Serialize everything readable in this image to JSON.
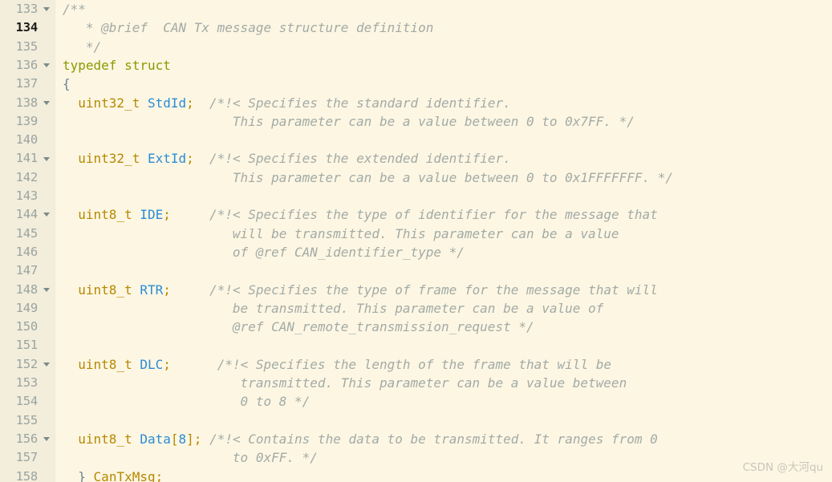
{
  "editor": {
    "language": "c",
    "first_line_number": 133,
    "current_line_number": 134,
    "colors": {
      "background": "#fdf6e3",
      "gutter_background": "#f3eddb",
      "line_number": "#9aa5a1",
      "current_line_number": "#1c1c1c",
      "comment": "#a2aba6",
      "type": "#b58900",
      "identifier": "#2b8cd4",
      "keyword": "#8a9a00",
      "punctuation": "#6a8391",
      "plain": "#657b83",
      "watermark": "#c9c6bd"
    }
  },
  "watermark": {
    "text": "CSDN @大河qu"
  },
  "lines": [
    {
      "number": "133",
      "fold": true,
      "current": false,
      "tokens": [
        {
          "t": "/**",
          "k": "com"
        }
      ]
    },
    {
      "number": "134",
      "fold": false,
      "current": true,
      "tokens": [
        {
          "t": "   * @brief  CAN Tx message structure definition",
          "k": "com"
        }
      ]
    },
    {
      "number": "135",
      "fold": false,
      "current": false,
      "tokens": [
        {
          "t": "   */",
          "k": "com"
        }
      ]
    },
    {
      "number": "136",
      "fold": true,
      "current": false,
      "tokens": [
        {
          "t": "typedef struct",
          "k": "kw"
        }
      ]
    },
    {
      "number": "137",
      "fold": false,
      "current": false,
      "tokens": [
        {
          "t": "{",
          "k": "punc"
        }
      ]
    },
    {
      "number": "138",
      "fold": true,
      "current": false,
      "tokens": [
        {
          "t": "  ",
          "k": "plain"
        },
        {
          "t": "uint32_t",
          "k": "type"
        },
        {
          "t": " ",
          "k": "plain"
        },
        {
          "t": "StdId",
          "k": "ident"
        },
        {
          "t": ";",
          "k": "type"
        },
        {
          "t": "  ",
          "k": "plain"
        },
        {
          "t": "/*!< Specifies the standard identifier.",
          "k": "com"
        }
      ]
    },
    {
      "number": "139",
      "fold": false,
      "current": false,
      "tokens": [
        {
          "t": "                      This parameter can be a value between 0 to 0x7FF. */",
          "k": "com"
        }
      ]
    },
    {
      "number": "140",
      "fold": false,
      "current": false,
      "tokens": []
    },
    {
      "number": "141",
      "fold": true,
      "current": false,
      "tokens": [
        {
          "t": "  ",
          "k": "plain"
        },
        {
          "t": "uint32_t",
          "k": "type"
        },
        {
          "t": " ",
          "k": "plain"
        },
        {
          "t": "ExtId",
          "k": "ident"
        },
        {
          "t": ";",
          "k": "type"
        },
        {
          "t": "  ",
          "k": "plain"
        },
        {
          "t": "/*!< Specifies the extended identifier.",
          "k": "com"
        }
      ]
    },
    {
      "number": "142",
      "fold": false,
      "current": false,
      "tokens": [
        {
          "t": "                      This parameter can be a value between 0 to 0x1FFFFFFF. */",
          "k": "com"
        }
      ]
    },
    {
      "number": "143",
      "fold": false,
      "current": false,
      "tokens": []
    },
    {
      "number": "144",
      "fold": true,
      "current": false,
      "tokens": [
        {
          "t": "  ",
          "k": "plain"
        },
        {
          "t": "uint8_t",
          "k": "type"
        },
        {
          "t": " ",
          "k": "plain"
        },
        {
          "t": "IDE",
          "k": "ident"
        },
        {
          "t": ";",
          "k": "type"
        },
        {
          "t": "     ",
          "k": "plain"
        },
        {
          "t": "/*!< Specifies the type of identifier for the message that",
          "k": "com"
        }
      ]
    },
    {
      "number": "145",
      "fold": false,
      "current": false,
      "tokens": [
        {
          "t": "                      will be transmitted. This parameter can be a value",
          "k": "com"
        }
      ]
    },
    {
      "number": "146",
      "fold": false,
      "current": false,
      "tokens": [
        {
          "t": "                      of @ref CAN_identifier_type */",
          "k": "com"
        }
      ]
    },
    {
      "number": "147",
      "fold": false,
      "current": false,
      "tokens": []
    },
    {
      "number": "148",
      "fold": true,
      "current": false,
      "tokens": [
        {
          "t": "  ",
          "k": "plain"
        },
        {
          "t": "uint8_t",
          "k": "type"
        },
        {
          "t": " ",
          "k": "plain"
        },
        {
          "t": "RTR",
          "k": "ident"
        },
        {
          "t": ";",
          "k": "type"
        },
        {
          "t": "     ",
          "k": "plain"
        },
        {
          "t": "/*!< Specifies the type of frame for the message that will",
          "k": "com"
        }
      ]
    },
    {
      "number": "149",
      "fold": false,
      "current": false,
      "tokens": [
        {
          "t": "                      be transmitted. This parameter can be a value of",
          "k": "com"
        }
      ]
    },
    {
      "number": "150",
      "fold": false,
      "current": false,
      "tokens": [
        {
          "t": "                      @ref CAN_remote_transmission_request */",
          "k": "com"
        }
      ]
    },
    {
      "number": "151",
      "fold": false,
      "current": false,
      "tokens": []
    },
    {
      "number": "152",
      "fold": true,
      "current": false,
      "tokens": [
        {
          "t": "  ",
          "k": "plain"
        },
        {
          "t": "uint8_t",
          "k": "type"
        },
        {
          "t": " ",
          "k": "plain"
        },
        {
          "t": "DLC",
          "k": "ident"
        },
        {
          "t": ";",
          "k": "type"
        },
        {
          "t": "     ",
          "k": "plain"
        },
        {
          "t": " /*!< Specifies the length of the frame that will be",
          "k": "com"
        }
      ]
    },
    {
      "number": "153",
      "fold": false,
      "current": false,
      "tokens": [
        {
          "t": "                       transmitted. This parameter can be a value between",
          "k": "com"
        }
      ]
    },
    {
      "number": "154",
      "fold": false,
      "current": false,
      "tokens": [
        {
          "t": "                       0 to 8 */",
          "k": "com"
        }
      ]
    },
    {
      "number": "155",
      "fold": false,
      "current": false,
      "tokens": []
    },
    {
      "number": "156",
      "fold": true,
      "current": false,
      "tokens": [
        {
          "t": "  ",
          "k": "plain"
        },
        {
          "t": "uint8_t",
          "k": "type"
        },
        {
          "t": " ",
          "k": "plain"
        },
        {
          "t": "Data",
          "k": "ident"
        },
        {
          "t": "[",
          "k": "type"
        },
        {
          "t": "8",
          "k": "ident"
        },
        {
          "t": "]",
          "k": "type"
        },
        {
          "t": ";",
          "k": "type"
        },
        {
          "t": " ",
          "k": "plain"
        },
        {
          "t": "/*!< Contains the data to be transmitted. It ranges from 0",
          "k": "com"
        }
      ]
    },
    {
      "number": "157",
      "fold": false,
      "current": false,
      "tokens": [
        {
          "t": "                      to 0xFF. */",
          "k": "com"
        }
      ]
    },
    {
      "number": "158",
      "fold": false,
      "current": false,
      "tokens": [
        {
          "t": "  ",
          "k": "plain"
        },
        {
          "t": "}",
          "k": "punc"
        },
        {
          "t": " ",
          "k": "plain"
        },
        {
          "t": "CanTxMsg",
          "k": "type"
        },
        {
          "t": ";",
          "k": "type"
        }
      ]
    }
  ]
}
